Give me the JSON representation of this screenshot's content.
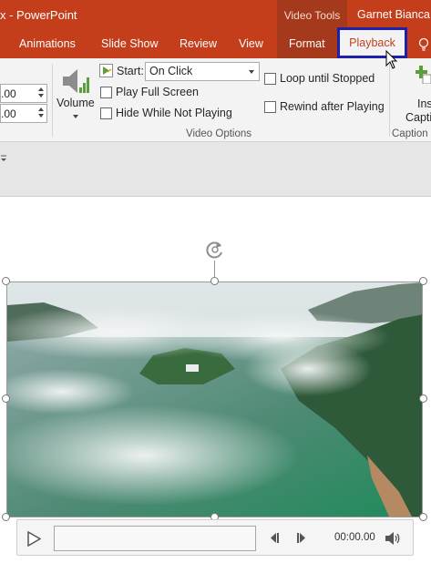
{
  "titlebar": {
    "app_title": "x - PowerPoint",
    "context_group": "Video Tools",
    "user": "Garnet Bianca"
  },
  "tabs": [
    {
      "label": "Animations"
    },
    {
      "label": "Slide Show"
    },
    {
      "label": "Review"
    },
    {
      "label": "View"
    },
    {
      "label": "Format"
    },
    {
      "label": "Playback",
      "active": true
    }
  ],
  "ribbon": {
    "fade_in": ".00",
    "fade_out": ".00",
    "volume_label": "Volume",
    "start_label": "Start:",
    "start_value": "On Click",
    "play_full_screen": "Play Full Screen",
    "hide_while_not_playing": "Hide While Not Playing",
    "loop_until_stopped": "Loop until Stopped",
    "rewind_after_playing": "Rewind after Playing",
    "video_options_group": "Video Options",
    "insert_captions_line1": "Ins",
    "insert_captions_line2": "Capti",
    "caption_group": "Caption"
  },
  "player": {
    "time": "00:00.00"
  },
  "colors": {
    "accent": "#c43e1c",
    "accent_dark": "#a5391b",
    "focus_border": "#1f1fa8"
  }
}
